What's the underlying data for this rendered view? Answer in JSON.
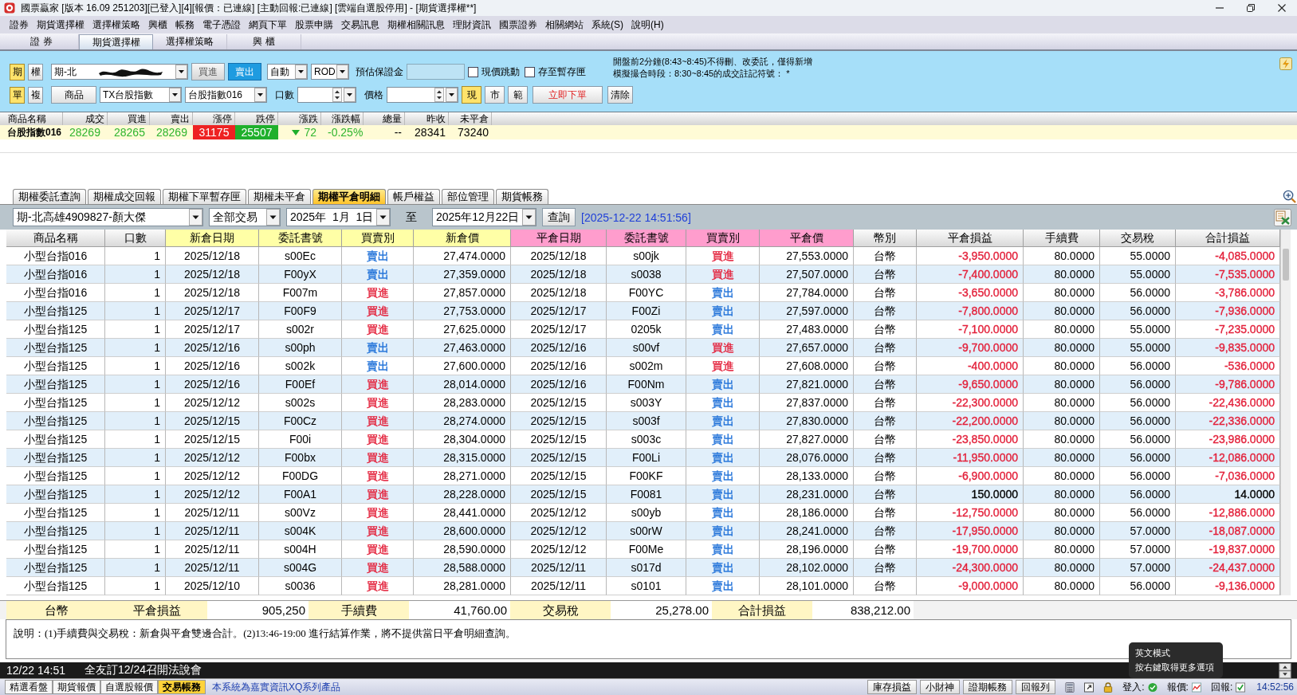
{
  "window": {
    "title": "國票贏家 [版本 16.09 251203][已登入][4][報價：已連線] [主動回報:已連線] [雲端自選股停用] - [期貨選擇權**]"
  },
  "menu": [
    "證券",
    "期貨選擇權",
    "選擇權策略",
    "興櫃",
    "帳務",
    "電子憑證",
    "網頁下單",
    "股票申購",
    "交易訊息",
    "期權相關訊息",
    "理財資訊",
    "國票證券",
    "相關網站",
    "系統(S)",
    "說明(H)"
  ],
  "main_tabs": [
    {
      "label": "證 券",
      "selected": false
    },
    {
      "label": "期貨選擇權",
      "selected": true
    },
    {
      "label": "選擇權策略",
      "selected": false
    },
    {
      "label": "興 櫃",
      "selected": false
    }
  ],
  "order_panel": {
    "market_toggle": [
      {
        "label": "期",
        "selected": true
      },
      {
        "label": "權",
        "selected": false
      }
    ],
    "account": "期-北",
    "side_buttons": [
      {
        "label": "買進",
        "selected": false
      },
      {
        "label": "賣出",
        "selected": true
      }
    ],
    "condition": "自動",
    "order_type": "ROD",
    "margin_label": "預估保證金",
    "options": [
      {
        "label": "現價跳動",
        "checked": false
      },
      {
        "label": "存至暫存匣",
        "checked": false
      }
    ],
    "notices": [
      "開盤前2分鐘(8:43~8:45)不得刪、改委託，僅得新增",
      "模擬撮合時段：8:30~8:45的成交註記符號： *"
    ],
    "mode_toggle": [
      {
        "label": "單",
        "selected": true
      },
      {
        "label": "複",
        "selected": false
      }
    ],
    "product_button": "商品",
    "product": "TX台股指數",
    "contract": "台股指數016",
    "quantity_label": "口數",
    "price_label": "價格",
    "price_buttons": [
      {
        "label": "現",
        "selected": true
      },
      {
        "label": "市",
        "selected": false
      },
      {
        "label": "範",
        "selected": false
      }
    ],
    "submit_button": "立即下單",
    "clear_button": "清除"
  },
  "quote_table": {
    "columns": [
      {
        "header": "商品名稱",
        "value": "台股指數016",
        "kind": "name"
      },
      {
        "header": "成交",
        "value": "28269",
        "kind": "down"
      },
      {
        "header": "買進",
        "value": "28265",
        "kind": "down"
      },
      {
        "header": "賣出",
        "value": "28269",
        "kind": "down"
      },
      {
        "header": "漲停",
        "value": "31175",
        "kind": "limit-up"
      },
      {
        "header": "跌停",
        "value": "25507",
        "kind": "limit-down"
      },
      {
        "header": "漲跌",
        "value": "72",
        "kind": "change-down"
      },
      {
        "header": "漲跌幅",
        "value": "-0.25%",
        "kind": "down"
      },
      {
        "header": "總量",
        "value": "--",
        "kind": "plain"
      },
      {
        "header": "昨收",
        "value": "28341",
        "kind": "plain"
      },
      {
        "header": "未平倉",
        "value": "73240",
        "kind": "plain"
      }
    ]
  },
  "detail_tabs": [
    {
      "label": "期權委託查詢",
      "selected": false
    },
    {
      "label": "期權成交回報",
      "selected": false
    },
    {
      "label": "期權下單暫存匣",
      "selected": false
    },
    {
      "label": "期權未平倉",
      "selected": false
    },
    {
      "label": "期權平倉明細",
      "selected": true
    },
    {
      "label": "帳戶權益",
      "selected": false
    },
    {
      "label": "部位管理",
      "selected": false
    },
    {
      "label": "期貨帳務",
      "selected": false
    }
  ],
  "filter": {
    "account": "期-北高雄4909827-顏大傑",
    "trade_type": "全部交易",
    "start_date": "2025年  1月  1日",
    "to_label": "至",
    "end_date": "2025年12月22日",
    "query_button": "查詢",
    "timestamp": "[2025-12-22 14:51:56]"
  },
  "table": {
    "columns": [
      {
        "label": "商品名稱",
        "kind": "plain"
      },
      {
        "label": "口數",
        "kind": "plain"
      },
      {
        "label": "新倉日期",
        "kind": "open"
      },
      {
        "label": "委託書號",
        "kind": "open"
      },
      {
        "label": "買賣別",
        "kind": "open"
      },
      {
        "label": "新倉價",
        "kind": "open"
      },
      {
        "label": "平倉日期",
        "kind": "close"
      },
      {
        "label": "委託書號",
        "kind": "close"
      },
      {
        "label": "買賣別",
        "kind": "close"
      },
      {
        "label": "平倉價",
        "kind": "close"
      },
      {
        "label": "幣別",
        "kind": "plain"
      },
      {
        "label": "平倉損益",
        "kind": "plain"
      },
      {
        "label": "手續費",
        "kind": "plain"
      },
      {
        "label": "交易稅",
        "kind": "plain"
      },
      {
        "label": "合計損益",
        "kind": "plain"
      }
    ],
    "rows": [
      {
        "product": "小型台指016",
        "qty": "1",
        "open_date": "2025/12/18",
        "open_order": "s00Ec",
        "open_side": {
          "text": "賣出",
          "color": "#1c6fd8"
        },
        "open_price": "27,474.0000",
        "close_date": "2025/12/18",
        "close_order": "s00jk",
        "close_side": {
          "text": "買進",
          "color": "#e3203a"
        },
        "close_price": "27,553.0000",
        "currency": "台幣",
        "close_pnl": {
          "text": "-3,950.0000",
          "color": "#e3203a"
        },
        "fee": "80.0000",
        "tax": "55.0000",
        "total_pnl": {
          "text": "-4,085.0000",
          "color": "#e3203a"
        }
      },
      {
        "product": "小型台指016",
        "qty": "1",
        "open_date": "2025/12/18",
        "open_order": "F00yX",
        "open_side": {
          "text": "賣出",
          "color": "#1c6fd8"
        },
        "open_price": "27,359.0000",
        "close_date": "2025/12/18",
        "close_order": "s0038",
        "close_side": {
          "text": "買進",
          "color": "#e3203a"
        },
        "close_price": "27,507.0000",
        "currency": "台幣",
        "close_pnl": {
          "text": "-7,400.0000",
          "color": "#e3203a"
        },
        "fee": "80.0000",
        "tax": "55.0000",
        "total_pnl": {
          "text": "-7,535.0000",
          "color": "#e3203a"
        }
      },
      {
        "product": "小型台指016",
        "qty": "1",
        "open_date": "2025/12/18",
        "open_order": "F007m",
        "open_side": {
          "text": "買進",
          "color": "#e3203a"
        },
        "open_price": "27,857.0000",
        "close_date": "2025/12/18",
        "close_order": "F00YC",
        "close_side": {
          "text": "賣出",
          "color": "#1c6fd8"
        },
        "close_price": "27,784.0000",
        "currency": "台幣",
        "close_pnl": {
          "text": "-3,650.0000",
          "color": "#e3203a"
        },
        "fee": "80.0000",
        "tax": "56.0000",
        "total_pnl": {
          "text": "-3,786.0000",
          "color": "#e3203a"
        }
      },
      {
        "product": "小型台指125",
        "qty": "1",
        "open_date": "2025/12/17",
        "open_order": "F00F9",
        "open_side": {
          "text": "買進",
          "color": "#e3203a"
        },
        "open_price": "27,753.0000",
        "close_date": "2025/12/17",
        "close_order": "F00Zi",
        "close_side": {
          "text": "賣出",
          "color": "#1c6fd8"
        },
        "close_price": "27,597.0000",
        "currency": "台幣",
        "close_pnl": {
          "text": "-7,800.0000",
          "color": "#e3203a"
        },
        "fee": "80.0000",
        "tax": "56.0000",
        "total_pnl": {
          "text": "-7,936.0000",
          "color": "#e3203a"
        }
      },
      {
        "product": "小型台指125",
        "qty": "1",
        "open_date": "2025/12/17",
        "open_order": "s002r",
        "open_side": {
          "text": "買進",
          "color": "#e3203a"
        },
        "open_price": "27,625.0000",
        "close_date": "2025/12/17",
        "close_order": "0205k",
        "close_side": {
          "text": "賣出",
          "color": "#1c6fd8"
        },
        "close_price": "27,483.0000",
        "currency": "台幣",
        "close_pnl": {
          "text": "-7,100.0000",
          "color": "#e3203a"
        },
        "fee": "80.0000",
        "tax": "55.0000",
        "total_pnl": {
          "text": "-7,235.0000",
          "color": "#e3203a"
        }
      },
      {
        "product": "小型台指125",
        "qty": "1",
        "open_date": "2025/12/16",
        "open_order": "s00ph",
        "open_side": {
          "text": "賣出",
          "color": "#1c6fd8"
        },
        "open_price": "27,463.0000",
        "close_date": "2025/12/16",
        "close_order": "s00vf",
        "close_side": {
          "text": "買進",
          "color": "#e3203a"
        },
        "close_price": "27,657.0000",
        "currency": "台幣",
        "close_pnl": {
          "text": "-9,700.0000",
          "color": "#e3203a"
        },
        "fee": "80.0000",
        "tax": "55.0000",
        "total_pnl": {
          "text": "-9,835.0000",
          "color": "#e3203a"
        }
      },
      {
        "product": "小型台指125",
        "qty": "1",
        "open_date": "2025/12/16",
        "open_order": "s002k",
        "open_side": {
          "text": "賣出",
          "color": "#1c6fd8"
        },
        "open_price": "27,600.0000",
        "close_date": "2025/12/16",
        "close_order": "s002m",
        "close_side": {
          "text": "買進",
          "color": "#e3203a"
        },
        "close_price": "27,608.0000",
        "currency": "台幣",
        "close_pnl": {
          "text": "-400.0000",
          "color": "#e3203a"
        },
        "fee": "80.0000",
        "tax": "56.0000",
        "total_pnl": {
          "text": "-536.0000",
          "color": "#e3203a"
        }
      },
      {
        "product": "小型台指125",
        "qty": "1",
        "open_date": "2025/12/16",
        "open_order": "F00Ef",
        "open_side": {
          "text": "買進",
          "color": "#e3203a"
        },
        "open_price": "28,014.0000",
        "close_date": "2025/12/16",
        "close_order": "F00Nm",
        "close_side": {
          "text": "賣出",
          "color": "#1c6fd8"
        },
        "close_price": "27,821.0000",
        "currency": "台幣",
        "close_pnl": {
          "text": "-9,650.0000",
          "color": "#e3203a"
        },
        "fee": "80.0000",
        "tax": "56.0000",
        "total_pnl": {
          "text": "-9,786.0000",
          "color": "#e3203a"
        }
      },
      {
        "product": "小型台指125",
        "qty": "1",
        "open_date": "2025/12/12",
        "open_order": "s002s",
        "open_side": {
          "text": "買進",
          "color": "#e3203a"
        },
        "open_price": "28,283.0000",
        "close_date": "2025/12/15",
        "close_order": "s003Y",
        "close_side": {
          "text": "賣出",
          "color": "#1c6fd8"
        },
        "close_price": "27,837.0000",
        "currency": "台幣",
        "close_pnl": {
          "text": "-22,300.0000",
          "color": "#e3203a"
        },
        "fee": "80.0000",
        "tax": "56.0000",
        "total_pnl": {
          "text": "-22,436.0000",
          "color": "#e3203a"
        }
      },
      {
        "product": "小型台指125",
        "qty": "1",
        "open_date": "2025/12/15",
        "open_order": "F00Cz",
        "open_side": {
          "text": "買進",
          "color": "#e3203a"
        },
        "open_price": "28,274.0000",
        "close_date": "2025/12/15",
        "close_order": "s003f",
        "close_side": {
          "text": "賣出",
          "color": "#1c6fd8"
        },
        "close_price": "27,830.0000",
        "currency": "台幣",
        "close_pnl": {
          "text": "-22,200.0000",
          "color": "#e3203a"
        },
        "fee": "80.0000",
        "tax": "56.0000",
        "total_pnl": {
          "text": "-22,336.0000",
          "color": "#e3203a"
        }
      },
      {
        "product": "小型台指125",
        "qty": "1",
        "open_date": "2025/12/15",
        "open_order": "F00i",
        "open_side": {
          "text": "買進",
          "color": "#e3203a"
        },
        "open_price": "28,304.0000",
        "close_date": "2025/12/15",
        "close_order": "s003c",
        "close_side": {
          "text": "賣出",
          "color": "#1c6fd8"
        },
        "close_price": "27,827.0000",
        "currency": "台幣",
        "close_pnl": {
          "text": "-23,850.0000",
          "color": "#e3203a"
        },
        "fee": "80.0000",
        "tax": "56.0000",
        "total_pnl": {
          "text": "-23,986.0000",
          "color": "#e3203a"
        }
      },
      {
        "product": "小型台指125",
        "qty": "1",
        "open_date": "2025/12/12",
        "open_order": "F00bx",
        "open_side": {
          "text": "買進",
          "color": "#e3203a"
        },
        "open_price": "28,315.0000",
        "close_date": "2025/12/15",
        "close_order": "F00Li",
        "close_side": {
          "text": "賣出",
          "color": "#1c6fd8"
        },
        "close_price": "28,076.0000",
        "currency": "台幣",
        "close_pnl": {
          "text": "-11,950.0000",
          "color": "#e3203a"
        },
        "fee": "80.0000",
        "tax": "56.0000",
        "total_pnl": {
          "text": "-12,086.0000",
          "color": "#e3203a"
        }
      },
      {
        "product": "小型台指125",
        "qty": "1",
        "open_date": "2025/12/12",
        "open_order": "F00DG",
        "open_side": {
          "text": "買進",
          "color": "#e3203a"
        },
        "open_price": "28,271.0000",
        "close_date": "2025/12/15",
        "close_order": "F00KF",
        "close_side": {
          "text": "賣出",
          "color": "#1c6fd8"
        },
        "close_price": "28,133.0000",
        "currency": "台幣",
        "close_pnl": {
          "text": "-6,900.0000",
          "color": "#e3203a"
        },
        "fee": "80.0000",
        "tax": "56.0000",
        "total_pnl": {
          "text": "-7,036.0000",
          "color": "#e3203a"
        }
      },
      {
        "product": "小型台指125",
        "qty": "1",
        "open_date": "2025/12/12",
        "open_order": "F00A1",
        "open_side": {
          "text": "買進",
          "color": "#e3203a"
        },
        "open_price": "28,228.0000",
        "close_date": "2025/12/15",
        "close_order": "F0081",
        "close_side": {
          "text": "賣出",
          "color": "#1c6fd8"
        },
        "close_price": "28,231.0000",
        "currency": "台幣",
        "close_pnl": {
          "text": "150.0000",
          "color": "#000000"
        },
        "fee": "80.0000",
        "tax": "56.0000",
        "total_pnl": {
          "text": "14.0000",
          "color": "#000000"
        }
      },
      {
        "product": "小型台指125",
        "qty": "1",
        "open_date": "2025/12/11",
        "open_order": "s00Vz",
        "open_side": {
          "text": "買進",
          "color": "#e3203a"
        },
        "open_price": "28,441.0000",
        "close_date": "2025/12/12",
        "close_order": "s00yb",
        "close_side": {
          "text": "賣出",
          "color": "#1c6fd8"
        },
        "close_price": "28,186.0000",
        "currency": "台幣",
        "close_pnl": {
          "text": "-12,750.0000",
          "color": "#e3203a"
        },
        "fee": "80.0000",
        "tax": "56.0000",
        "total_pnl": {
          "text": "-12,886.0000",
          "color": "#e3203a"
        }
      },
      {
        "product": "小型台指125",
        "qty": "1",
        "open_date": "2025/12/11",
        "open_order": "s004K",
        "open_side": {
          "text": "買進",
          "color": "#e3203a"
        },
        "open_price": "28,600.0000",
        "close_date": "2025/12/12",
        "close_order": "s00rW",
        "close_side": {
          "text": "賣出",
          "color": "#1c6fd8"
        },
        "close_price": "28,241.0000",
        "currency": "台幣",
        "close_pnl": {
          "text": "-17,950.0000",
          "color": "#e3203a"
        },
        "fee": "80.0000",
        "tax": "57.0000",
        "total_pnl": {
          "text": "-18,087.0000",
          "color": "#e3203a"
        }
      },
      {
        "product": "小型台指125",
        "qty": "1",
        "open_date": "2025/12/11",
        "open_order": "s004H",
        "open_side": {
          "text": "買進",
          "color": "#e3203a"
        },
        "open_price": "28,590.0000",
        "close_date": "2025/12/12",
        "close_order": "F00Me",
        "close_side": {
          "text": "賣出",
          "color": "#1c6fd8"
        },
        "close_price": "28,196.0000",
        "currency": "台幣",
        "close_pnl": {
          "text": "-19,700.0000",
          "color": "#e3203a"
        },
        "fee": "80.0000",
        "tax": "57.0000",
        "total_pnl": {
          "text": "-19,837.0000",
          "color": "#e3203a"
        }
      },
      {
        "product": "小型台指125",
        "qty": "1",
        "open_date": "2025/12/11",
        "open_order": "s004G",
        "open_side": {
          "text": "買進",
          "color": "#e3203a"
        },
        "open_price": "28,588.0000",
        "close_date": "2025/12/11",
        "close_order": "s017d",
        "close_side": {
          "text": "賣出",
          "color": "#1c6fd8"
        },
        "close_price": "28,102.0000",
        "currency": "台幣",
        "close_pnl": {
          "text": "-24,300.0000",
          "color": "#e3203a"
        },
        "fee": "80.0000",
        "tax": "57.0000",
        "total_pnl": {
          "text": "-24,437.0000",
          "color": "#e3203a"
        }
      },
      {
        "product": "小型台指125",
        "qty": "1",
        "open_date": "2025/12/10",
        "open_order": "s0036",
        "open_side": {
          "text": "買進",
          "color": "#e3203a"
        },
        "open_price": "28,281.0000",
        "close_date": "2025/12/11",
        "close_order": "s0101",
        "close_side": {
          "text": "賣出",
          "color": "#1c6fd8"
        },
        "close_price": "28,101.0000",
        "currency": "台幣",
        "close_pnl": {
          "text": "-9,000.0000",
          "color": "#e3203a"
        },
        "fee": "80.0000",
        "tax": "56.0000",
        "total_pnl": {
          "text": "-9,136.0000",
          "color": "#e3203a"
        }
      }
    ]
  },
  "summary": {
    "currency": "台幣",
    "items": [
      {
        "label": "平倉損益",
        "value": "905,250"
      },
      {
        "label": "手續費",
        "value": "41,760.00"
      },
      {
        "label": "交易稅",
        "value": "25,278.00"
      },
      {
        "label": "合計損益",
        "value": "838,212.00"
      }
    ]
  },
  "note": "說明：(1)手續費與交易稅：新倉與平倉雙邊合計。(2)13:46-19:00 進行結算作業，將不提供當日平倉明細查詢。",
  "news_ticker": {
    "time": "12/22 14:51",
    "headline": "全友訂12/24召開法說會"
  },
  "bottom_tabs": [
    {
      "label": "精選看盤",
      "selected": false
    },
    {
      "label": "期貨報價",
      "selected": false
    },
    {
      "label": "自選股報價",
      "selected": false
    },
    {
      "label": "交易帳務",
      "selected": true
    }
  ],
  "product_note": "本系統為嘉實資訊XQ系列產品",
  "bottom_buttons": [
    "庫存損益",
    "小財神",
    "證期帳務",
    "回報列"
  ],
  "status": [
    {
      "label": "登入:",
      "kind": "ok-dot"
    },
    {
      "label": "報價:",
      "kind": "chart"
    },
    {
      "label": "回報:",
      "kind": "ok-box"
    }
  ],
  "clock": "14:52:56",
  "tooltip": [
    "英文模式",
    "按右鍵取得更多選項"
  ]
}
